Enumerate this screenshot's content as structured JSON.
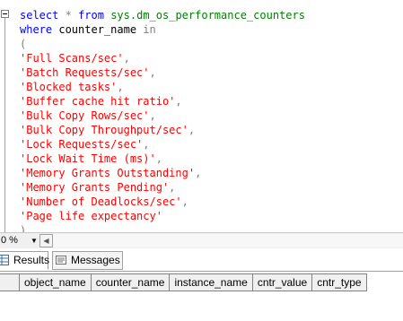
{
  "editor": {
    "lines": [
      [
        {
          "t": "select",
          "c": "kw"
        },
        {
          "t": " ",
          "c": "plain"
        },
        {
          "t": "*",
          "c": "gr"
        },
        {
          "t": " ",
          "c": "plain"
        },
        {
          "t": "from",
          "c": "kw"
        },
        {
          "t": " ",
          "c": "plain"
        },
        {
          "t": "sys.dm_os_performance_counters",
          "c": "sysobj"
        }
      ],
      [
        {
          "t": "where",
          "c": "kw"
        },
        {
          "t": " counter_name ",
          "c": "plain"
        },
        {
          "t": "in",
          "c": "gr"
        }
      ],
      [
        {
          "t": "(",
          "c": "gr"
        }
      ],
      [
        {
          "t": "'Full Scans/sec'",
          "c": "str"
        },
        {
          "t": ",",
          "c": "gr"
        }
      ],
      [
        {
          "t": "'Batch Requests/sec'",
          "c": "str"
        },
        {
          "t": ",",
          "c": "gr"
        }
      ],
      [
        {
          "t": "'Blocked tasks'",
          "c": "str"
        },
        {
          "t": ",",
          "c": "gr"
        }
      ],
      [
        {
          "t": "'Buffer cache hit ratio'",
          "c": "str"
        },
        {
          "t": ",",
          "c": "gr"
        }
      ],
      [
        {
          "t": "'Bulk Copy Rows/sec'",
          "c": "str"
        },
        {
          "t": ",",
          "c": "gr"
        }
      ],
      [
        {
          "t": "'Bulk Copy Throughput/sec'",
          "c": "str"
        },
        {
          "t": ",",
          "c": "gr"
        }
      ],
      [
        {
          "t": "'Lock Requests/sec'",
          "c": "str"
        },
        {
          "t": ",",
          "c": "gr"
        }
      ],
      [
        {
          "t": "'Lock Wait Time (ms)'",
          "c": "str"
        },
        {
          "t": ",",
          "c": "gr"
        }
      ],
      [
        {
          "t": "'Memory Grants Outstanding'",
          "c": "str"
        },
        {
          "t": ",",
          "c": "gr"
        }
      ],
      [
        {
          "t": "'Memory Grants Pending'",
          "c": "str"
        },
        {
          "t": ",",
          "c": "gr"
        }
      ],
      [
        {
          "t": "'Number of Deadlocks/sec'",
          "c": "str"
        },
        {
          "t": ",",
          "c": "gr"
        }
      ],
      [
        {
          "t": "'Page life expectancy'",
          "c": "str"
        }
      ],
      [
        {
          "t": ")",
          "c": "gr"
        }
      ]
    ]
  },
  "zoom": {
    "value": "0 %"
  },
  "tabs": [
    {
      "label": "Results",
      "icon": "grid-icon",
      "active": true
    },
    {
      "label": "Messages",
      "icon": "messages-icon",
      "active": false
    }
  ],
  "grid": {
    "columns": [
      "object_name",
      "counter_name",
      "instance_name",
      "cntr_value",
      "cntr_type"
    ]
  },
  "colors": {
    "keyword": "#0000ff",
    "string": "#ff0000",
    "system_object": "#008000",
    "operator": "#808080"
  }
}
